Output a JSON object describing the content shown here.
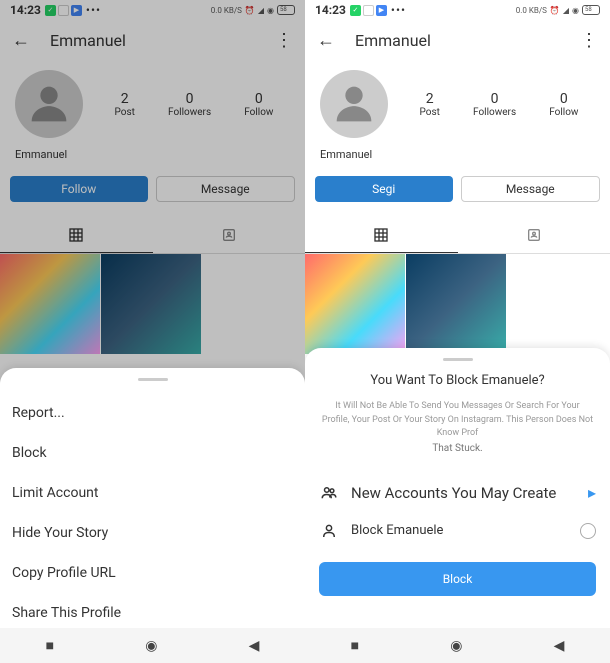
{
  "status": {
    "time": "14:23",
    "data": "0.0 KB/S"
  },
  "left": {
    "header": {
      "title": "Emmanuel"
    },
    "stats": {
      "posts": {
        "count": "2",
        "label": "Post"
      },
      "followers": {
        "count": "0",
        "label": "Followers"
      },
      "following": {
        "count": "0",
        "label": "Follow"
      }
    },
    "username": "Emmanuel",
    "buttons": {
      "follow": "Follow",
      "message": "Message"
    },
    "sheet": {
      "report": "Report...",
      "block": "Block",
      "limit": "Limit Account",
      "hide": "Hide Your Story",
      "copy": "Copy Profile URL",
      "share": "Share This Profile"
    }
  },
  "right": {
    "header": {
      "title": "Emmanuel"
    },
    "stats": {
      "posts": {
        "count": "2",
        "label": "Post"
      },
      "followers": {
        "count": "0",
        "label": "Followers"
      },
      "following": {
        "count": "0",
        "label": "Follow"
      }
    },
    "username": "Emmanuel",
    "buttons": {
      "follow": "Segi",
      "message": "Message"
    },
    "sheet": {
      "title": "You Want To Block Emanuele?",
      "desc1": "It Will Not Be Able To Send You Messages Or Search For Your Profile, Your",
      "desc2": "Post Or Your Story On Instagram. This Person Does Not Know Prof",
      "desc3": "That Stuck.",
      "row1": "New Accounts You May Create",
      "row2": "Block Emanuele",
      "button": "Block"
    }
  }
}
